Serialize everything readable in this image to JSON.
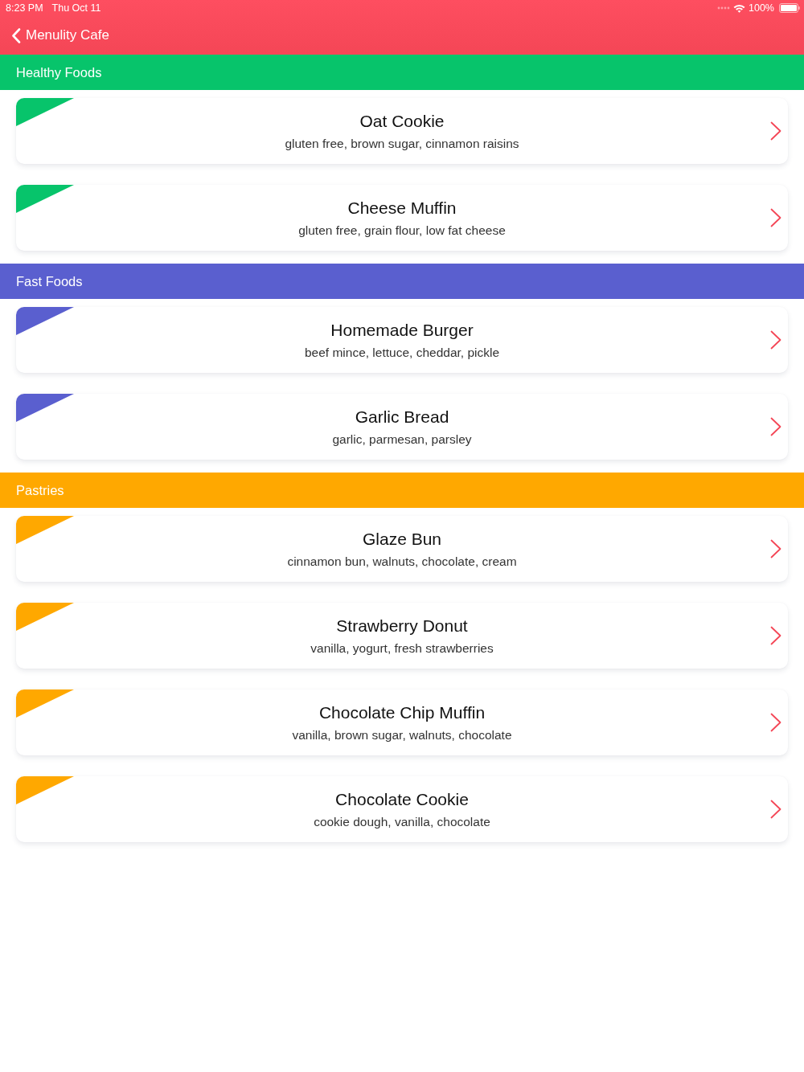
{
  "status_bar": {
    "time": "8:23 PM",
    "date": "Thu Oct 11",
    "battery": "100%"
  },
  "nav_bar": {
    "back_label": "Menulity Cafe"
  },
  "sections": [
    {
      "title": "Healthy Foods",
      "color": "#07c46b",
      "items": [
        {
          "name": "Oat Cookie",
          "ingredients": "gluten free, brown sugar, cinnamon raisins"
        },
        {
          "name": "Cheese Muffin",
          "ingredients": "gluten free, grain flour, low fat cheese"
        }
      ]
    },
    {
      "title": "Fast Foods",
      "color": "#5a5fcf",
      "items": [
        {
          "name": "Homemade Burger",
          "ingredients": "beef mince, lettuce, cheddar, pickle"
        },
        {
          "name": "Garlic Bread",
          "ingredients": "garlic, parmesan, parsley"
        }
      ]
    },
    {
      "title": "Pastries",
      "color": "#ffa800",
      "items": [
        {
          "name": "Glaze Bun",
          "ingredients": "cinnamon bun, walnuts, chocolate, cream"
        },
        {
          "name": "Strawberry Donut",
          "ingredients": "vanilla, yogurt, fresh strawberries"
        },
        {
          "name": "Chocolate Chip Muffin",
          "ingredients": "vanilla, brown sugar, walnuts, chocolate"
        },
        {
          "name": "Chocolate Cookie",
          "ingredients": "cookie dough, vanilla, chocolate"
        }
      ]
    }
  ]
}
